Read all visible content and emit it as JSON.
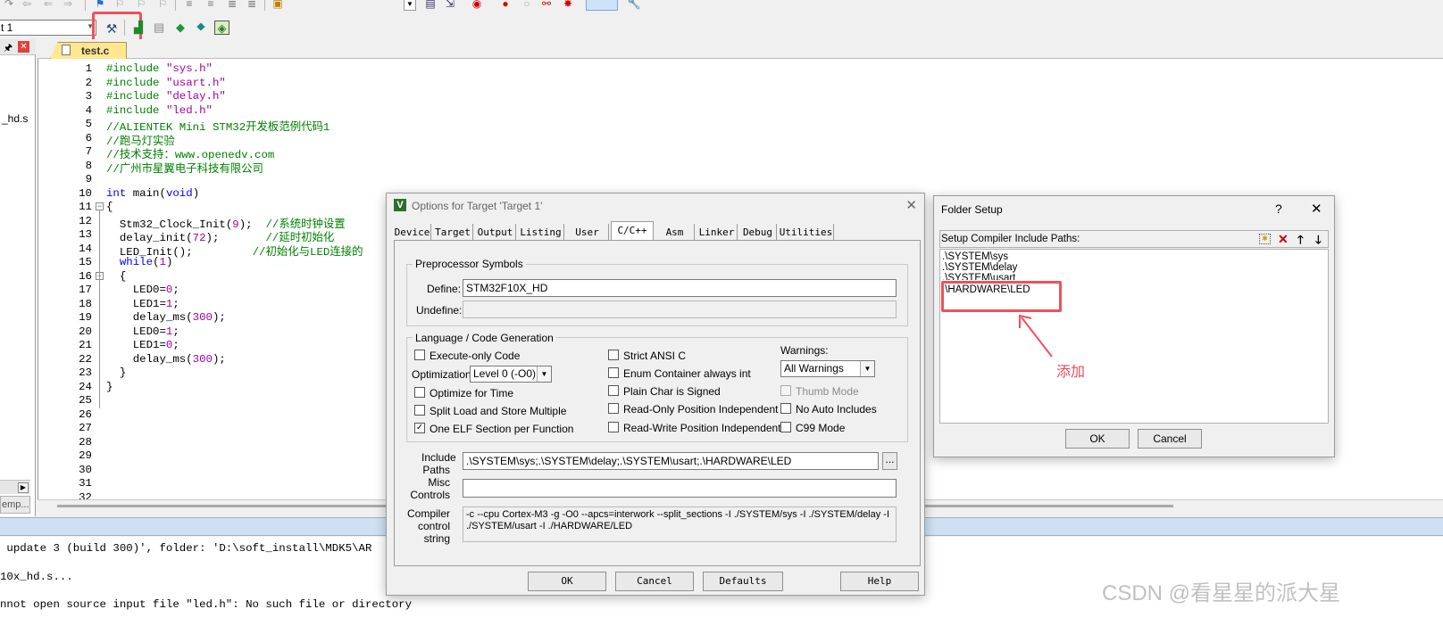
{
  "toolbar": {
    "target_name": "t 1"
  },
  "project_panel": {
    "file_fragment": "_hd.s",
    "bottom_tab": "emp..."
  },
  "editor": {
    "tab_label": "test.c",
    "line_numbers": [
      "1",
      "2",
      "3",
      "4",
      "5",
      "6",
      "7",
      "8",
      "9",
      "10",
      "11",
      "12",
      "13",
      "14",
      "15",
      "16",
      "17",
      "18",
      "19",
      "20",
      "21",
      "22",
      "23",
      "24",
      "25",
      "26",
      "27",
      "28",
      "29",
      "30",
      "31",
      "32"
    ],
    "code": {
      "l1": {
        "kw": "#include",
        "str": "\"sys.h\""
      },
      "l2": {
        "kw": "#include",
        "str": "\"usart.h\""
      },
      "l3": {
        "kw": "#include",
        "str": "\"delay.h\""
      },
      "l4": {
        "kw": "#include",
        "str": "\"led.h\""
      },
      "l5": "//ALIENTEK Mini STM32开发板范例代码1",
      "l6": "//跑马灯实验",
      "l7": "//技术支持：www.openedv.com",
      "l8": "//广州市星翼电子科技有限公司",
      "l10a": "int",
      "l10b": " main(",
      "l10c": "void",
      "l10d": ")",
      "l11": "{",
      "l12a": "  Stm32_Clock_Init(",
      "l12n": "9",
      "l12b": ");  ",
      "l12c": "//系统时钟设置",
      "l13a": "  delay_init(",
      "l13n": "72",
      "l13b": ");       ",
      "l13c": "//延时初始化",
      "l14a": "  LED_Init();         ",
      "l14c": "//初始化与LED连接的",
      "l15a": "  ",
      "l15k": "while",
      "l15b": "(",
      "l15n": "1",
      "l15c": ")",
      "l16": "  {",
      "l17a": "    LED0=",
      "l17n": "0",
      "l17b": ";",
      "l18a": "    LED1=",
      "l18n": "1",
      "l18b": ";",
      "l19a": "    delay_ms(",
      "l19n": "300",
      "l19b": ");",
      "l20a": "    LED0=",
      "l20n": "1",
      "l20b": ";",
      "l21a": "    LED1=",
      "l21n": "0",
      "l21b": ";",
      "l22a": "    delay_ms(",
      "l22n": "300",
      "l22b": ");",
      "l23": "  }",
      "l24": "}"
    }
  },
  "build_output": {
    "line1": " update 3 (build 300)', folder: 'D:\\soft_install\\MDK5\\AR",
    "line2": "10x_hd.s...",
    "line3": "nnot open source input file \"led.h\": No such file or directory"
  },
  "options_dialog": {
    "title": "Options for Target 'Target 1'",
    "tabs": [
      "Device",
      "Target",
      "Output",
      "Listing",
      "User",
      "C/C++",
      "Asm",
      "Linker",
      "Debug",
      "Utilities"
    ],
    "active_tab": "C/C++",
    "preprocessor": {
      "group_title": "Preprocessor Symbols",
      "define_label": "Define:",
      "define_value": "STM32F10X_HD",
      "undefine_label": "Undefine:",
      "undefine_value": ""
    },
    "language": {
      "group_title": "Language / Code Generation",
      "execute_only": "Execute-only Code",
      "optimization_label": "Optimization:",
      "optimization_value": "Level 0 (-O0)",
      "optimize_time": "Optimize for Time",
      "split_load": "Split Load and Store Multiple",
      "one_elf": "One ELF Section per Function",
      "one_elf_mark": "✓",
      "strict_ansi": "Strict ANSI C",
      "enum_container": "Enum Container always int",
      "plain_char": "Plain Char is Signed",
      "ro_pi": "Read-Only Position Independent",
      "rw_pi": "Read-Write Position Independent",
      "warnings_label": "Warnings:",
      "warnings_value": "All Warnings",
      "thumb_mode": "Thumb Mode",
      "no_auto_includes": "No Auto Includes",
      "c99_mode": "C99 Mode"
    },
    "include_label_1": "Include",
    "include_label_2": "Paths",
    "include_value": ".\\SYSTEM\\sys;.\\SYSTEM\\delay;.\\SYSTEM\\usart;.\\HARDWARE\\LED",
    "browse_label": "...",
    "misc_label_1": "Misc",
    "misc_label_2": "Controls",
    "misc_value": "",
    "compiler_label_1": "Compiler",
    "compiler_label_2": "control",
    "compiler_label_3": "string",
    "compiler_line1": "-c --cpu Cortex-M3 -g -O0 --apcs=interwork --split_sections -I ./SYSTEM/sys -I ./SYSTEM/delay -I",
    "compiler_line2": "./SYSTEM/usart -I ./HARDWARE/LED",
    "buttons": {
      "ok": "OK",
      "cancel": "Cancel",
      "defaults": "Defaults",
      "help": "Help"
    }
  },
  "folder_dialog": {
    "title": "Folder Setup",
    "help_glyph": "?",
    "close_glyph": "✕",
    "list_label": "Setup Compiler Include Paths:",
    "paths": [
      ".\\SYSTEM\\sys",
      ".\\SYSTEM\\delay",
      ".\\SYSTEM\\usart",
      ".\\HARDWARE\\LED"
    ],
    "ok": "OK",
    "cancel": "Cancel"
  },
  "annotation": {
    "text": "添加",
    "color": "#e84d5b"
  },
  "watermark": "CSDN @看星星的派大星"
}
